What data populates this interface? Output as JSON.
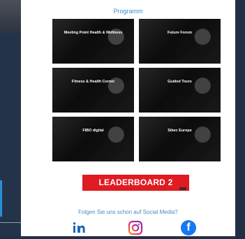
{
  "page": {
    "title": "Programm"
  },
  "cards": [
    {
      "title": "Meeting Point Health & Wellness",
      "description": ""
    },
    {
      "title": "Future Forum",
      "description": ""
    },
    {
      "title": "Fitness & Health Corner",
      "description": ""
    },
    {
      "title": "Guided Tours",
      "description": ""
    },
    {
      "title": "FIBO digital",
      "description": ""
    },
    {
      "title": "Sibec Europe",
      "description": ""
    }
  ],
  "leaderboard": {
    "label": "LEADERBOARD 2"
  },
  "social": {
    "title": "Folgen Sie uns schon auf Social Media?",
    "icons": [
      "linkedin-icon",
      "instagram-icon",
      "facebook-icon"
    ]
  },
  "colors": {
    "accent": "#3a8ed3",
    "leaderboard_red": "#e01b22",
    "panel_bg": "#ffffff",
    "outer_bg": "#1f2f45"
  }
}
